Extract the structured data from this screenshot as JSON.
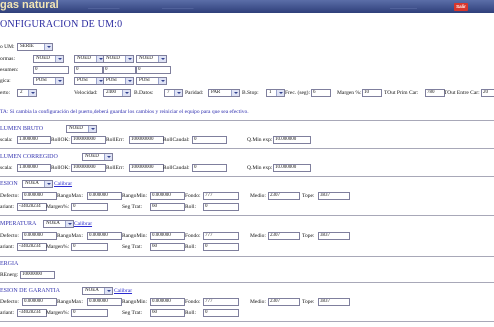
{
  "header": {
    "logo": "gas natural",
    "close_label": "Salir"
  },
  "title": "ONFIGURACION DE UM:0",
  "config": {
    "um_label": "o UM:",
    "um_value": "SERIE",
    "row_formas_label": "ormas:",
    "formas": [
      "NOED",
      "NOED",
      "NOED",
      "NOED"
    ],
    "row_resumen_label": "esumen:",
    "resumen": [
      "0",
      "0",
      "0",
      "0"
    ],
    "row_logica_label": "gica:",
    "logica": [
      "POSI",
      "POSI",
      "POSI",
      "POSI"
    ],
    "row_puerto_label": "erto:",
    "puerto": "2",
    "velocidad_label": "Velocidad:",
    "velocidad": "2400",
    "bdatos_label": "B.Datos:",
    "bdatos": "7",
    "paridad_label": "Paridad:",
    "paridad": "PAR",
    "bstop_label": "B.Stop:",
    "bstop": "1",
    "frec_label": "Frec. (seg):",
    "frec": "6",
    "margen_label": "Margen %:",
    "margen": "10",
    "tout_prim_label": "TOut Prim Car:",
    "tout_prim": "780",
    "tout_entre_label": "TOut Entre Car:",
    "tout_entre": "20"
  },
  "note": "TA: Si cambia la configuración del puerto,deberá guardar los cambios y reiniciar el equipo para que sea efectivo.",
  "vol_bruto": {
    "title": "LUMEN BRUTO",
    "sel": "NOED",
    "escala_label": "scala:",
    "escala": "1.000000",
    "rollok_label": "RollOK:",
    "rollok": "100000000",
    "rollerr_label": "RollErr:",
    "rollerr": "100000000",
    "rollcaudal_label": "RollCaudal:",
    "rollcaudal": "0",
    "qmin_label": "Q.Min exp:",
    "qmin": "10.000000"
  },
  "vol_corregido": {
    "title": "LUMEN CORREGIDO",
    "sel": "NOED",
    "escala_label": "scala:",
    "escala": "1.000000",
    "rollok_label": "RollOK:",
    "rollok": "100000000",
    "rollerr_label": "RollErr:",
    "rollerr": "100000000",
    "rollcaudal_label": "RollCaudal:",
    "rollcaudal": "0",
    "qmin_label": "Q.Min exp:",
    "qmin": "10.000000"
  },
  "presion": {
    "title": "ESION",
    "sel": "NOEA",
    "calibrar": "Calibrar",
    "defecto_label": "Defecto:",
    "defecto": "0.000000",
    "rangomax_label": "RangoMax:",
    "rangomax": "0.000000",
    "rangomin_label": "RangoMin:",
    "rangomin": "0.000000",
    "fondo_label": "Fondo:",
    "fondo": "777",
    "medio_label": "Medio:",
    "medio": "2307",
    "tope_label": "Tope:",
    "tope": "3837",
    "variant_label": "ariant:",
    "variant": "-34028234",
    "margen_label": "Margen%:",
    "margen": "0",
    "segtrat_label": "Seg Trat:",
    "segtrat": "60",
    "roll_label": "Roll:",
    "roll": "0"
  },
  "temperatura": {
    "title": "MPERATURA",
    "sel": "NOEA",
    "calibrar": "Calibrar",
    "defecto_label": "Defecto:",
    "defecto": "0.000000",
    "rangomax_label": "RangoMax:",
    "rangomax": "0.000000",
    "rangomin_label": "RangoMin:",
    "rangomin": "0.000000",
    "fondo_label": "Fondo:",
    "fondo": "777",
    "medio_label": "Medio:",
    "medio": "2307",
    "tope_label": "Tope:",
    "tope": "3837",
    "variant_label": "ariant:",
    "variant": "-34028234",
    "margen_label": "Margen%:",
    "margen": "0",
    "segtrat_label": "Seg Trat:",
    "segtrat": "60",
    "roll_label": "Roll:",
    "roll": "0"
  },
  "energia": {
    "title": "ERGIA",
    "energ_label": "REnerg:",
    "energ": "10000000"
  },
  "presion_garantia": {
    "title": "ESION DE GARANTIA",
    "sel": "NOEA",
    "calibrar": "Calibrar",
    "defecto_label": "Defecto:",
    "defecto": "0.000000",
    "rangomax_label": "RangoMax:",
    "rangomax": "0.000000",
    "rangomin_label": "RangoMin:",
    "rangomin": "0.000000",
    "fondo_label": "Fondo:",
    "fondo": "777",
    "medio_label": "Medio:",
    "medio": "2307",
    "tope_label": "Tope:",
    "tope": "3837",
    "variant_label": "ariant:",
    "variant": "-34028234",
    "margen_label": "Margen%:",
    "margen": "0",
    "segtrat_label": "Seg Trat:",
    "segtrat": "60",
    "roll_label": "Roll:",
    "roll": "0"
  }
}
